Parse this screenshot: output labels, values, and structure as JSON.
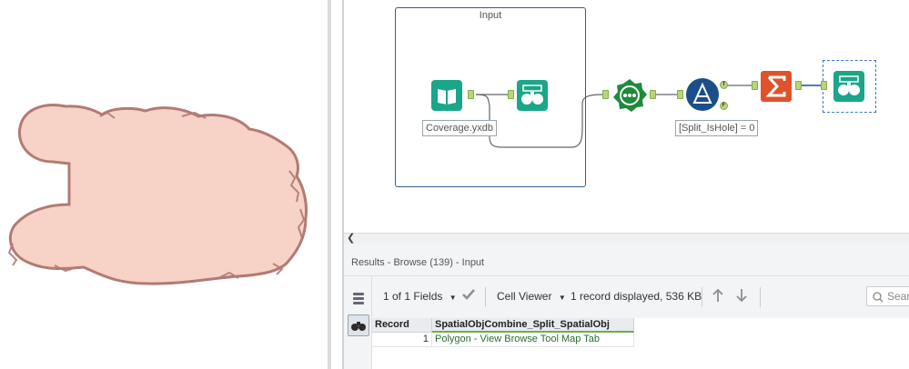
{
  "canvas": {
    "container_title": "Input",
    "input_caption": "Coverage.yxdb",
    "filter_caption": "[Split_IsHole] = 0",
    "filter_true_label": "T",
    "filter_false_label": "F"
  },
  "results": {
    "header": "Results - Browse (139) - Input",
    "fields_label": "1 of 1 Fields",
    "viewer_label": "Cell Viewer",
    "record_info": "1 record displayed, 536 KB",
    "search_placeholder": "Search",
    "columns": [
      "Record",
      "SpatialObjCombine_Split_SpatialObj"
    ],
    "rows": [
      {
        "record": "1",
        "value": "Polygon - View Browse Tool Map Tab"
      }
    ]
  },
  "colors": {
    "polygon_fill": "#f6d3c6",
    "polygon_stroke": "#b37a74",
    "container_border": "#3a5b8c",
    "input_tool": "#1aa689",
    "browse_tool": "#1aa689",
    "spatial_tool": "#1f8a3c",
    "filter_tool": "#1b4f8a",
    "summarize_tool": "#e0522b",
    "anchor": "#b7d57a"
  },
  "icons": [
    "book-icon",
    "binoculars-icon",
    "spatial-gear-icon",
    "filter-flask-icon",
    "sigma-icon",
    "stack-icon",
    "search-icon",
    "chevron-left-icon",
    "check-icon",
    "arrow-up-icon",
    "arrow-down-icon",
    "dropdown-arrow-icon"
  ]
}
